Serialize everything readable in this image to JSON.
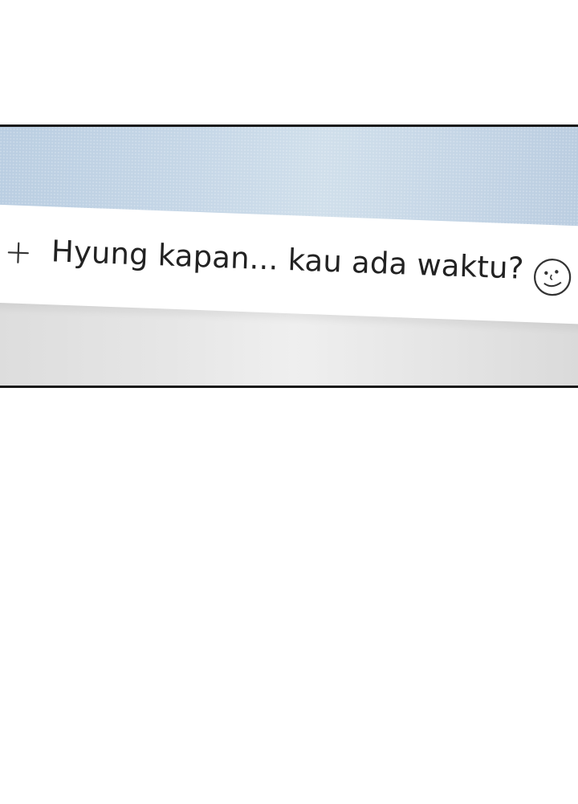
{
  "chat_input": {
    "message_text": "Hyung kapan... kau ada waktu?",
    "add_icon": "plus-icon",
    "emoji_icon": "smiley-icon"
  },
  "colors": {
    "sky": "#c6d7e7",
    "bar": "#ffffff",
    "floor": "#e6e6e6",
    "border": "#1a1a1a",
    "text": "#222222"
  }
}
